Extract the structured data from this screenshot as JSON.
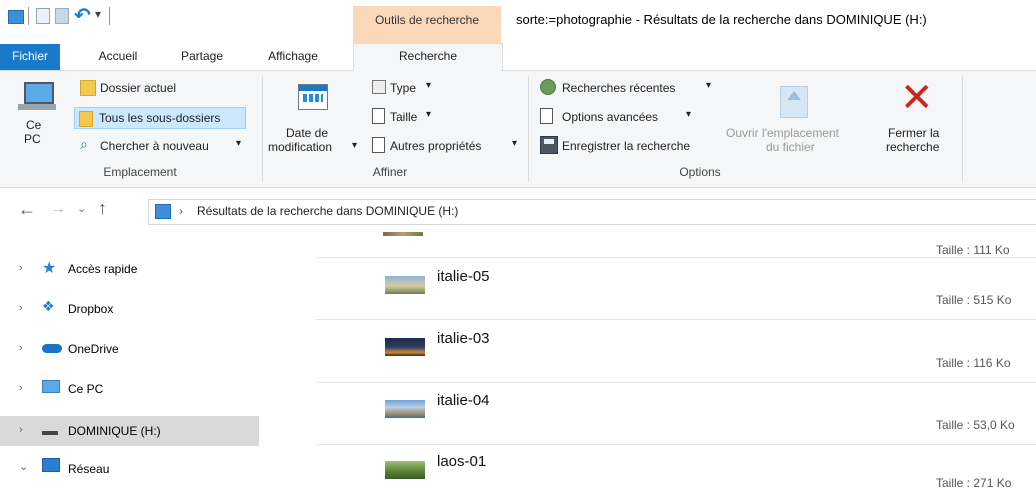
{
  "titlebar": {
    "context_tab_label": "Outils de recherche",
    "window_title": "sorte:=photographie - Résultats de la recherche dans DOMINIQUE (H:)"
  },
  "tabs": {
    "file": "Fichier",
    "home": "Accueil",
    "share": "Partage",
    "view": "Affichage",
    "search": "Recherche"
  },
  "ribbon": {
    "location": {
      "this_pc": [
        "Ce",
        "PC"
      ],
      "current_folder": "Dossier actuel",
      "all_subfolders": "Tous les sous-dossiers",
      "search_again": "Chercher à nouveau",
      "group": "Emplacement"
    },
    "refine": {
      "date_modified": [
        "Date de",
        "modification"
      ],
      "type": "Type",
      "size": "Taille",
      "other_props": "Autres propriétés",
      "group": "Affiner"
    },
    "options": {
      "recent_searches": "Recherches récentes",
      "advanced_options": "Options avancées",
      "save_search": "Enregistrer la recherche",
      "open_location": [
        "Ouvrir l'emplacement",
        "du fichier"
      ],
      "close_search": [
        "Fermer la",
        "recherche"
      ],
      "group": "Options"
    }
  },
  "address": {
    "path": "Résultats de la recherche dans DOMINIQUE (H:)"
  },
  "nav": [
    {
      "label": "Accès rapide",
      "icon": "star-icon",
      "chevron": "›"
    },
    {
      "label": "Dropbox",
      "icon": "dropbox-icon",
      "chevron": "›"
    },
    {
      "label": "OneDrive",
      "icon": "onedrive-cloud-icon",
      "chevron": "›"
    },
    {
      "label": "Ce PC",
      "icon": "computer-icon",
      "chevron": "›"
    },
    {
      "label": "DOMINIQUE (H:)",
      "icon": "drive-icon",
      "chevron": "›",
      "selected": true
    },
    {
      "label": "Réseau",
      "icon": "network-icon",
      "chevron": "⌄"
    }
  ],
  "results": [
    {
      "name": "",
      "size": "Taille : 111 Ko"
    },
    {
      "name": "italie-05",
      "size": "Taille : 515 Ko"
    },
    {
      "name": "italie-03",
      "size": "Taille : 116 Ko"
    },
    {
      "name": "italie-04",
      "size": "Taille : 53,0 Ko"
    },
    {
      "name": "laos-01",
      "size": "Taille : 271 Ko"
    }
  ],
  "colors": {
    "file_tab": "#1979ca",
    "context_tab": "#f9d9b9",
    "selected_button": "#cce8ff",
    "nav_selected": "#d9d9d9",
    "close_x": "#c42b1c"
  }
}
